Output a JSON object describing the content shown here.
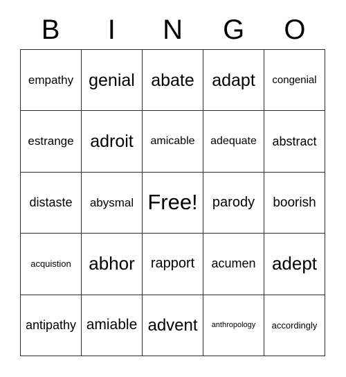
{
  "card": {
    "type": "bingo-card",
    "header_letters": [
      "B",
      "I",
      "N",
      "G",
      "O"
    ],
    "rows": 5,
    "columns": 5,
    "free_space": {
      "row": 2,
      "column": 2,
      "label": "Free!"
    },
    "grid": [
      [
        {
          "text": "empathy",
          "font_size": 17
        },
        {
          "text": "genial",
          "font_size": 25
        },
        {
          "text": "abate",
          "font_size": 25
        },
        {
          "text": "adapt",
          "font_size": 25
        },
        {
          "text": "congenial",
          "font_size": 15
        }
      ],
      [
        {
          "text": "estrange",
          "font_size": 17
        },
        {
          "text": "adroit",
          "font_size": 25
        },
        {
          "text": "amicable",
          "font_size": 16
        },
        {
          "text": "adequate",
          "font_size": 16
        },
        {
          "text": "abstract",
          "font_size": 18
        }
      ],
      [
        {
          "text": "distaste",
          "font_size": 18
        },
        {
          "text": "abysmal",
          "font_size": 17
        },
        {
          "text": "Free!",
          "font_size": 31
        },
        {
          "text": "parody",
          "font_size": 20
        },
        {
          "text": "boorish",
          "font_size": 19
        }
      ],
      [
        {
          "text": "acquistion",
          "font_size": 13
        },
        {
          "text": "abhor",
          "font_size": 26
        },
        {
          "text": "rapport",
          "font_size": 20
        },
        {
          "text": "acumen",
          "font_size": 18
        },
        {
          "text": "adept",
          "font_size": 26
        }
      ],
      [
        {
          "text": "antipathy",
          "font_size": 18
        },
        {
          "text": "amiable",
          "font_size": 21
        },
        {
          "text": "advent",
          "font_size": 24
        },
        {
          "text": "anthropology",
          "font_size": 11
        },
        {
          "text": "accordingly",
          "font_size": 13
        }
      ]
    ]
  },
  "colors": {
    "background": "#ffffff",
    "text": "#000000",
    "grid_line": "#2b2b2b"
  }
}
